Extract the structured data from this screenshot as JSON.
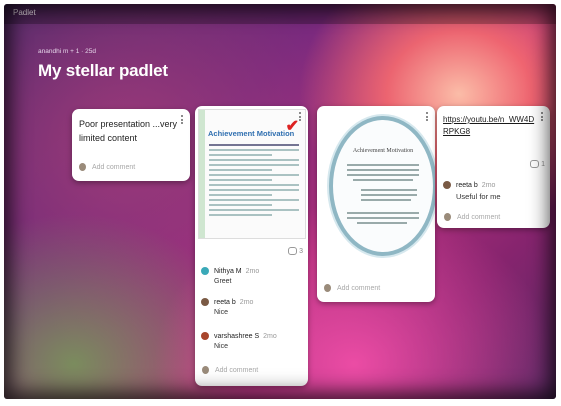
{
  "app": {
    "brand": "Padlet"
  },
  "board": {
    "meta": "anandhi m  + 1  · 25d",
    "title": "My stellar padlet"
  },
  "cards": [
    {
      "title": "Poor presentation ...very limited content",
      "add_comment": "Add comment"
    },
    {
      "image_title": "Achievement Motivation",
      "comment_count": "3",
      "comments": [
        {
          "name": "Nithya M",
          "time": "2mo",
          "text": "Greet",
          "avatar_color": "#3aa9b8"
        },
        {
          "name": "reeta b",
          "time": "2mo",
          "text": "Nice",
          "avatar_color": "#7a5a44"
        },
        {
          "name": "varshashree S",
          "time": "2mo",
          "text": "Nice",
          "avatar_color": "#a8452c"
        }
      ],
      "add_comment": "Add comment"
    },
    {
      "image_title": "Achievement Motivation",
      "add_comment": "Add comment"
    },
    {
      "link": "https://youtu.be/n_WW4DRPKG8",
      "comment_count": "1",
      "comments": [
        {
          "name": "reeta b",
          "time": "2mo",
          "text": "Useful for me",
          "avatar_color": "#7a5a44"
        }
      ],
      "add_comment": "Add comment"
    }
  ]
}
